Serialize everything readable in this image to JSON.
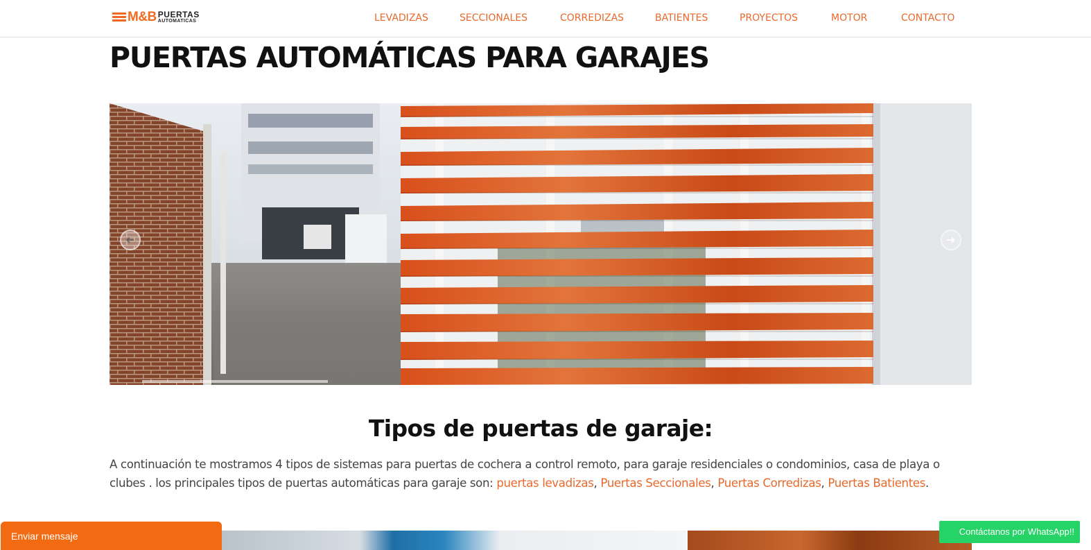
{
  "header": {
    "logo_mark_text": "M&B",
    "logo_line1": "PUERTAS",
    "logo_line2": "AUTOMATICAS",
    "nav": [
      "LEVADIZAS",
      "SECCIONALES",
      "CORREDIZAS",
      "BATIENTES",
      "PROYECTOS",
      "MOTOR",
      "CONTACTO"
    ]
  },
  "main": {
    "title": "PUERTAS AUTOMÁTICAS PARA GARAJES",
    "slider": {
      "prev_icon": "arrow-left-icon",
      "next_icon": "arrow-right-icon"
    },
    "section_title": "Tipos de puertas de garaje:",
    "paragraph_text": "A continuación te mostramos 4 tipos de sistemas para puertas de cochera a control remoto,  para garaje residenciales o condominios, casa de playa o clubes . los principales tipos de puertas automáticas para garaje son: ",
    "links": [
      "puertas levadizas",
      "Puertas Seccionales",
      "Puertas Corredizas",
      "Puertas Batientes"
    ],
    "separator": ", ",
    "end_punct": "."
  },
  "widgets": {
    "message_label": "Enviar mensaje",
    "whatsapp_label": "Contáctanos por WhatsApp!!"
  },
  "colors": {
    "accent": "#e8692b",
    "whatsapp": "#25d366",
    "message": "#f26a12"
  }
}
